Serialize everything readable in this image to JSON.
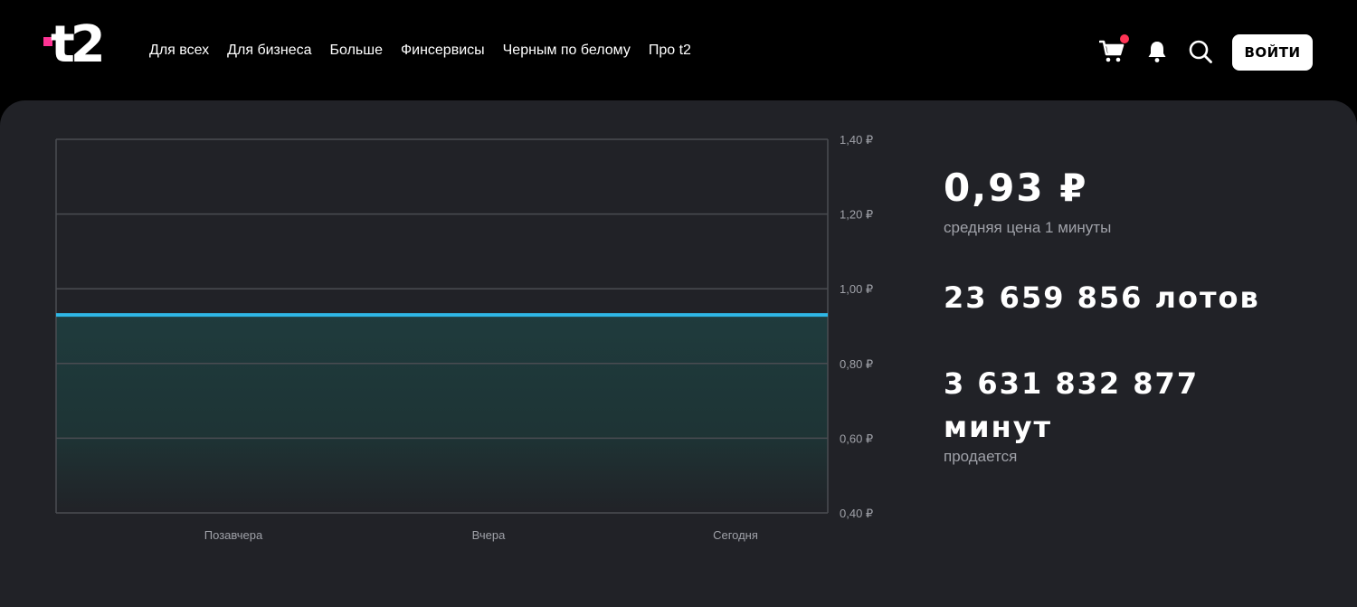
{
  "header": {
    "logo_text": "t2",
    "nav": [
      "Для всех",
      "Для бизнеса",
      "Больше",
      "Финсервисы",
      "Черным по белому",
      "Про t2"
    ],
    "login_label": "ВОЙТИ",
    "icons": [
      "cart-icon",
      "bell-icon",
      "search-icon"
    ],
    "cart_has_notification": true
  },
  "colors": {
    "accent_line": "#2fb7e6",
    "notification": "#ff3455",
    "logo_dot": "#ff3495",
    "panel_bg": "#212227"
  },
  "stats": {
    "price": "0,93 ₽",
    "price_label": "средняя цена 1 минуты",
    "lots": "23 659 856 лотов",
    "minutes": "3 631 832 877 минут",
    "minutes_label": "продается"
  },
  "chart_data": {
    "type": "area",
    "categories": [
      "Позавчера",
      "Вчера",
      "Сегодня"
    ],
    "values": [
      0.93,
      0.93,
      0.93
    ],
    "ylim": [
      0.4,
      1.4
    ],
    "yticks": [
      "1,40 ₽",
      "1,20 ₽",
      "1,00 ₽",
      "0,80 ₽",
      "0,60 ₽",
      "0,40 ₽"
    ],
    "ytick_values": [
      1.4,
      1.2,
      1.0,
      0.8,
      0.6,
      0.4
    ],
    "grid": true,
    "y_axis_side": "right"
  }
}
